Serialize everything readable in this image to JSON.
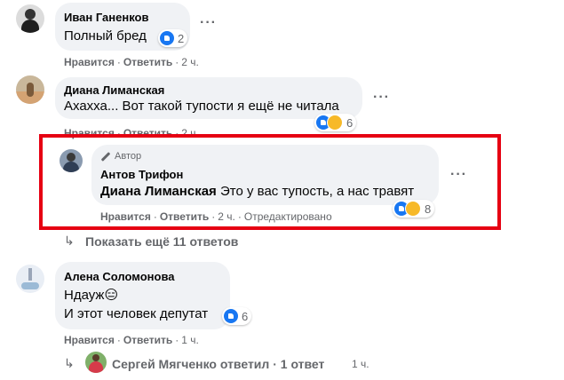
{
  "comments": [
    {
      "author": "Иван Ганенков",
      "lines": [
        "Полный бред"
      ],
      "reaction_count": "2",
      "actions": {
        "like": "Нравится",
        "reply": "Ответить",
        "time": "2 ч."
      }
    },
    {
      "author": "Диана Лиманская",
      "lines": [
        "Ахахха... Вот такой тупости я ещё не читала"
      ],
      "reaction_count": "6",
      "actions": {
        "like": "Нравится",
        "reply": "Ответить",
        "time": "2 ч."
      }
    },
    {
      "author_badge": "Автор",
      "author": "Антов Трифон",
      "mention": "Диана Лиманская",
      "text": "Это у вас тупость, а нас травят",
      "reaction_count": "8",
      "actions": {
        "like": "Нравится",
        "reply": "Ответить",
        "time": "2 ч.",
        "edited": "Отредактировано"
      }
    },
    {
      "author": "Алена Соломонова",
      "lines": [
        "Ндауж😑",
        "И этот человек депутат"
      ],
      "reaction_count": "6",
      "actions": {
        "like": "Нравится",
        "reply": "Ответить",
        "time": "1 ч."
      }
    }
  ],
  "more_replies": "Показать ещё 11 ответов",
  "reply_summary": {
    "name": "Сергей Мягченко",
    "verb": "ответил",
    "count": "1 ответ",
    "time": "1 ч."
  },
  "colors": {
    "highlight": "#e60012",
    "like_blue": "#1877f2",
    "muted": "#65676b",
    "bubble": "#f0f2f5"
  }
}
